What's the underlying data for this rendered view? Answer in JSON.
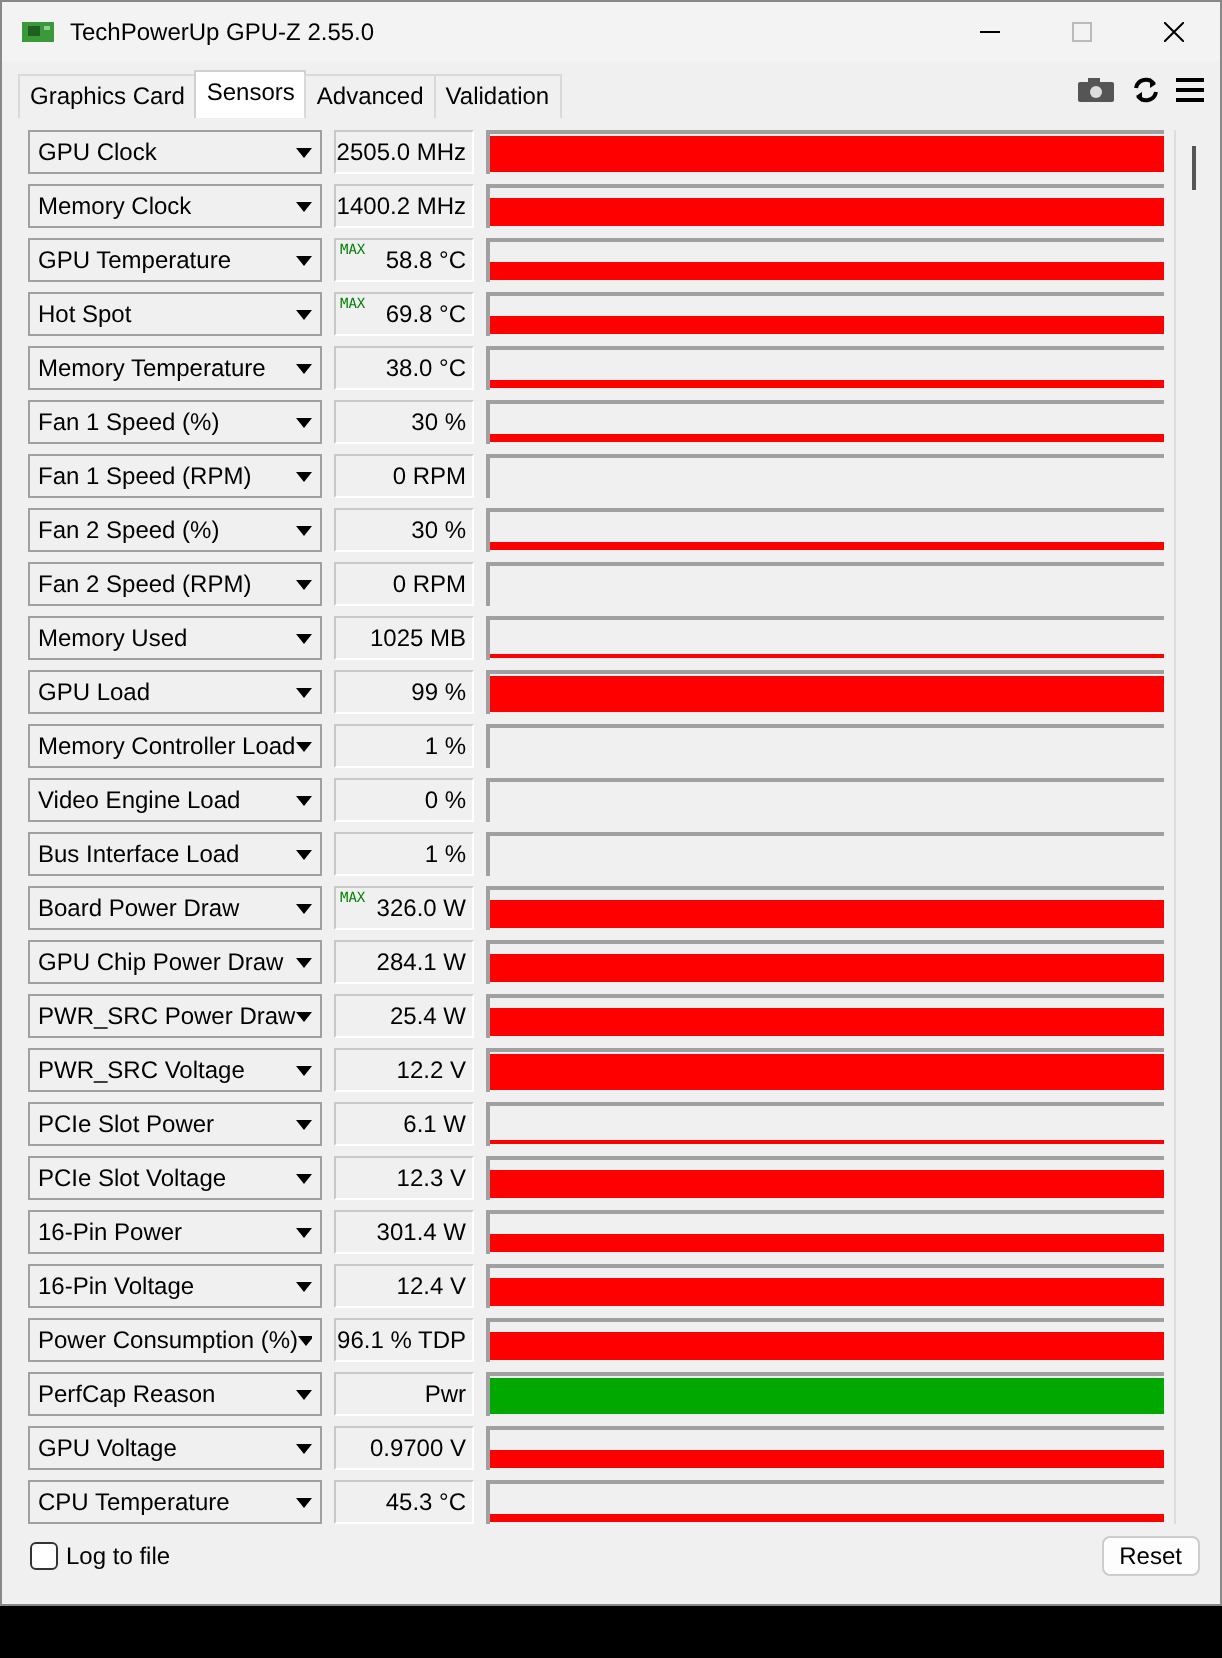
{
  "window": {
    "title": "TechPowerUp GPU-Z 2.55.0"
  },
  "tabs": [
    {
      "label": "Graphics Card",
      "selected": false
    },
    {
      "label": "Sensors",
      "selected": true
    },
    {
      "label": "Advanced",
      "selected": false
    },
    {
      "label": "Validation",
      "selected": false
    }
  ],
  "rows": [
    {
      "name": "GPU Clock",
      "value": "2505.0 MHz",
      "kind": "full",
      "color": "#ff0000"
    },
    {
      "name": "Memory Clock",
      "value": "1400.2 MHz",
      "kind": "high",
      "color": "#ff0000"
    },
    {
      "name": "GPU Temperature",
      "max_label": "MAX",
      "value": "58.8 °C",
      "kind": "mid",
      "color": "#ff0000"
    },
    {
      "name": "Hot Spot",
      "max_label": "MAX",
      "value": "69.8 °C",
      "kind": "mid",
      "color": "#ff0000"
    },
    {
      "name": "Memory Temperature",
      "value": "38.0 °C",
      "kind": "low",
      "color": "#ff0000"
    },
    {
      "name": "Fan 1 Speed (%)",
      "value": "30 %",
      "kind": "low",
      "color": "#ff0000"
    },
    {
      "name": "Fan 1 Speed (RPM)",
      "value": "0 RPM",
      "kind": "empty"
    },
    {
      "name": "Fan 2 Speed (%)",
      "value": "30 %",
      "kind": "low",
      "color": "#ff0000"
    },
    {
      "name": "Fan 2 Speed (RPM)",
      "value": "0 RPM",
      "kind": "empty"
    },
    {
      "name": "Memory Used",
      "value": "1025 MB",
      "kind": "flat",
      "color": "#ff0000"
    },
    {
      "name": "GPU Load",
      "value": "99 %",
      "kind": "full",
      "color": "#ff0000"
    },
    {
      "name": "Memory Controller Load",
      "value": "1 %",
      "kind": "empty"
    },
    {
      "name": "Video Engine Load",
      "value": "0 %",
      "kind": "empty"
    },
    {
      "name": "Bus Interface Load",
      "value": "1 %",
      "kind": "empty"
    },
    {
      "name": "Board Power Draw",
      "max_label": "MAX",
      "value": "326.0 W",
      "kind": "high",
      "color": "#ff0000"
    },
    {
      "name": "GPU Chip Power Draw",
      "value": "284.1 W",
      "kind": "high",
      "color": "#ff0000"
    },
    {
      "name": "PWR_SRC Power Draw",
      "value": "25.4 W",
      "kind": "high",
      "color": "#ff0000"
    },
    {
      "name": "PWR_SRC Voltage",
      "value": "12.2 V",
      "kind": "full",
      "color": "#ff0000"
    },
    {
      "name": "PCIe Slot Power",
      "value": "6.1 W",
      "kind": "flat",
      "color": "#ff0000"
    },
    {
      "name": "PCIe Slot Voltage",
      "value": "12.3 V",
      "kind": "high",
      "color": "#ff0000"
    },
    {
      "name": "16-Pin Power",
      "value": "301.4 W",
      "kind": "mid",
      "color": "#ff0000"
    },
    {
      "name": "16-Pin Voltage",
      "value": "12.4 V",
      "kind": "high",
      "color": "#ff0000"
    },
    {
      "name": "Power Consumption (%)",
      "value": "96.1 % TDP",
      "kind": "high",
      "color": "#ff0000"
    },
    {
      "name": "PerfCap Reason",
      "value": "Pwr",
      "kind": "full",
      "color": "#00a800"
    },
    {
      "name": "GPU Voltage",
      "value": "0.9700 V",
      "kind": "mid",
      "color": "#ff0000"
    },
    {
      "name": "CPU Temperature",
      "value": "45.3 °C",
      "kind": "low",
      "color": "#ff0000"
    }
  ],
  "log_to_file": {
    "label": "Log to file",
    "checked": false
  },
  "reset_button": "Reset"
}
